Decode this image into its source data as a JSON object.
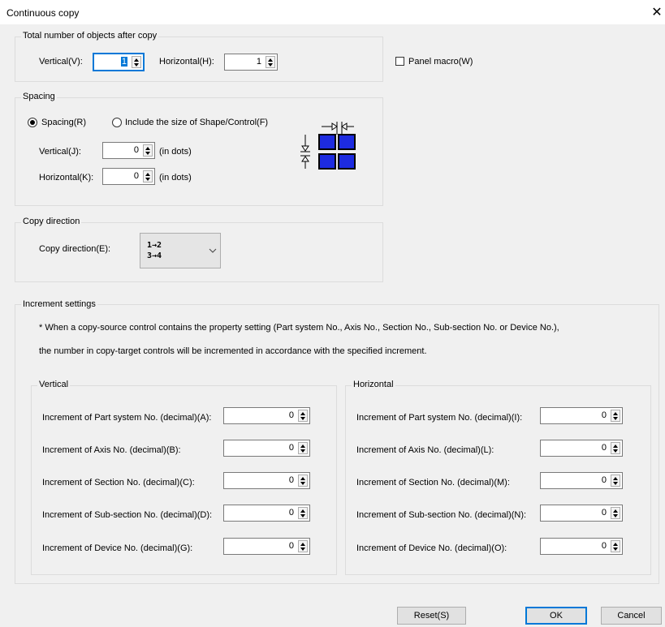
{
  "window": {
    "title": "Continuous copy",
    "close_glyph": "✕"
  },
  "total": {
    "legend": "Total number of objects after copy",
    "vertical_label": "Vertical(V):",
    "vertical_value": "1",
    "horizontal_label": "Horizontal(H):",
    "horizontal_value": "1"
  },
  "panel_macro_label": "Panel macro(W)",
  "spacing": {
    "legend": "Spacing",
    "radio_spacing": "Spacing(R)",
    "radio_include": "Include the size of Shape/Control(F)",
    "vertical_label": "Vertical(J):",
    "vertical_value": "0",
    "horizontal_label": "Horizontal(K):",
    "horizontal_value": "0",
    "unit": "(in dots)"
  },
  "copy_direction": {
    "legend": "Copy direction",
    "label": "Copy direction(E):",
    "icon_top": "1→2",
    "icon_bottom": "3→4"
  },
  "increment": {
    "legend": "Increment settings",
    "note_line1": "* When a copy-source control contains the property setting (Part system No., Axis No., Section No., Sub-section No. or Device No.),",
    "note_line2": "the number in copy-target controls will be incremented in accordance with the specified increment.",
    "vertical": {
      "legend": "Vertical",
      "rows": [
        {
          "label": "Increment of Part system No. (decimal)(A):",
          "value": "0"
        },
        {
          "label": "Increment of Axis No. (decimal)(B):",
          "value": "0"
        },
        {
          "label": "Increment of Section No. (decimal)(C):",
          "value": "0"
        },
        {
          "label": "Increment of Sub-section No. (decimal)(D):",
          "value": "0"
        },
        {
          "label": "Increment of Device No. (decimal)(G):",
          "value": "0"
        }
      ]
    },
    "horizontal": {
      "legend": "Horizontal",
      "rows": [
        {
          "label": "Increment of Part system No. (decimal)(I):",
          "value": "0"
        },
        {
          "label": "Increment of Axis No. (decimal)(L):",
          "value": "0"
        },
        {
          "label": "Increment of Section No. (decimal)(M):",
          "value": "0"
        },
        {
          "label": "Increment of Sub-section No. (decimal)(N):",
          "value": "0"
        },
        {
          "label": "Increment of Device No. (decimal)(O):",
          "value": "0"
        }
      ]
    }
  },
  "buttons": {
    "reset": "Reset(S)",
    "ok": "OK",
    "cancel": "Cancel"
  },
  "colors": {
    "focus": "#0078d7",
    "grid_cell": "#1d2be0"
  }
}
